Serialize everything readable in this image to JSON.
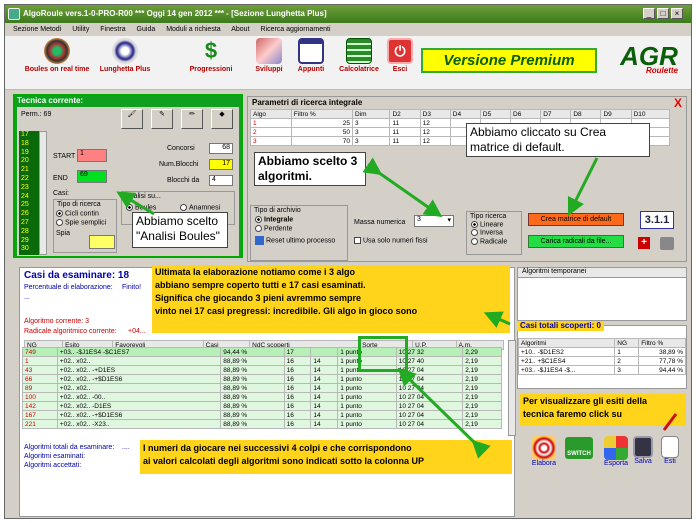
{
  "window": {
    "title": "AlgoRoule vers.1-0-PRO-R00  ***  Oggi 14 gen 2012  ***  - [Sezione Lunghetta Plus]"
  },
  "menu": [
    "Sezione Metodi",
    "Utility",
    "Finestra",
    "Guida",
    "Moduli a richiesta",
    "About",
    "Ricerca aggiornamenti"
  ],
  "toolbar": {
    "items": [
      "Boules on real time",
      "Lunghetta Plus",
      "Progressioni",
      "Sviluppi",
      "Appunti",
      "Calcolatrice",
      "Esci"
    ],
    "premium": "Versione Premium",
    "logo_main": "AGR",
    "logo_sub": "Roulette"
  },
  "left": {
    "title": "Tecnica corrente:",
    "perm": "Perm.: 69",
    "numbers": [
      "17",
      "18",
      "19",
      "20",
      "21",
      "22",
      "23",
      "24",
      "25",
      "26",
      "27",
      "28",
      "29",
      "30"
    ],
    "concorsi_label": "Concorsi",
    "concorsi_val": "68",
    "start_label": "START",
    "start_val": "1",
    "num_blocchi_label": "Num.Blocchi",
    "num_blocchi_val": "17",
    "end_label": "END",
    "end_val": "69",
    "blocchi_da_label": "Blocchi da",
    "blocchi_da_val": "4",
    "casi": "Casi:",
    "tipo_ricerca": "Tipo di ricerca",
    "cicli": "Cicli contin",
    "spie": "Spie semplici",
    "spia": "Spia",
    "analisi": "Analisi su...",
    "boules": "Boules",
    "anamnesi": "Anamnesi"
  },
  "params": {
    "title": "Parametri di ricerca integrale",
    "close": "X",
    "headers": [
      "Algo",
      "Filtro %",
      "Dim",
      "D2",
      "D3",
      "D4",
      "D5",
      "D6",
      "D7",
      "D8",
      "D9",
      "D10"
    ],
    "rows": [
      [
        "1",
        "25",
        "3",
        "11",
        "12"
      ],
      [
        "2",
        "50",
        "3",
        "11",
        "12"
      ],
      [
        "3",
        "70",
        "3",
        "11",
        "12"
      ]
    ],
    "archivio": "Tipo di archivio",
    "integrale": "Integrale",
    "perdente": "Perdente",
    "reset": "Reset ultimo processo",
    "massa": "Massa numerica",
    "massa_val": "3",
    "solo_fissi": "Usa solo numeri fissi",
    "tipo_ricerca": "Tipo ricerca",
    "lineare": "Lineare",
    "inversa": "Inversa",
    "radicale": "Radicale",
    "crea_btn": "Crea matrice di default",
    "carica_btn": "Carica radicali da file...",
    "version": "3.1.1"
  },
  "casi": {
    "title": "Casi da esaminare: 18",
    "perc": "Percentuale di elaborazione:",
    "finito": "Finito!",
    "dots": "...",
    "algo": "Algoritmo corrente: 3",
    "radice": "Radicale algoritmico corrente:",
    "radice_val": "+04...",
    "headers": [
      "NG",
      "Esito",
      "Favorevoli",
      "Casi",
      "NdC scoperti",
      "Sorte",
      "U.P.",
      "A.m."
    ],
    "rows": [
      [
        "749",
        "+03.. -$J1ES4 -$C1ES7",
        "94,44 %",
        "17",
        "",
        "1 punto",
        "10 27 32",
        "2,29"
      ],
      [
        "1",
        "+02.. x02..",
        "88,89 %",
        "16",
        "14",
        "1 punto",
        "10 27 40",
        "2,19"
      ],
      [
        "43",
        "+02.. x02.. -+D1ES",
        "88,89 %",
        "16",
        "14",
        "1 punto",
        "10 27 04",
        "2,19"
      ],
      [
        "66",
        "+02.. x02.. -+$D1ES6",
        "88,89 %",
        "16",
        "14",
        "1 punto",
        "10 27 04",
        "2,19"
      ],
      [
        "89",
        "+02.. x02..",
        "88,89 %",
        "16",
        "14",
        "1 punto",
        "10 27 04",
        "2,19"
      ],
      [
        "100",
        "+02.. x02.. -00..",
        "88,89 %",
        "16",
        "14",
        "1 punto",
        "10 27 04",
        "2,19"
      ],
      [
        "142",
        "+02.. x02.. -D1ES",
        "88,89 %",
        "16",
        "14",
        "1 punto",
        "10 27 04",
        "2,19"
      ],
      [
        "167",
        "+02.. x02.. -+$D1ES6",
        "88,89 %",
        "16",
        "14",
        "1 punto",
        "10 27 04",
        "2,19"
      ],
      [
        "221",
        "+02.. x02.. -X23..",
        "88,89 %",
        "16",
        "14",
        "1 punto",
        "10 27 04",
        "2,19"
      ]
    ],
    "tot1": "Algoritmi totali da esaminare:",
    "tot2": "Algoritmi esaminati:",
    "tot3": "Algoritmi accettati:",
    "tot_dots": "...."
  },
  "right": {
    "temp": "Algoritmi temporanei",
    "scoperti_label": "Casi totali scoperti:",
    "scoperti_val": "0",
    "headers": [
      "Algoritmi",
      "NG",
      "Filtro %"
    ],
    "rows": [
      [
        "+10.. -$D1ES2",
        "1",
        "38,89 %"
      ],
      [
        "+21.. +$C1ES4",
        "2",
        "77,78 %"
      ],
      [
        "+03.. -$J1ES4 -$...",
        "3",
        "94,44 %"
      ]
    ]
  },
  "bottom": [
    "Elabora",
    "Esporta",
    "Salva",
    "Esti"
  ],
  "switch": "SWITCH",
  "callouts": {
    "algo3": "Abbiamo scelto 3 algoritmi.",
    "crea": "Abbiamo cliccato su Crea matrice di default.",
    "boules": "Abbiamo scelto \"Analisi Boules\"",
    "main": [
      "Ultimata la elaborazione notiamo come i 3 algo",
      "abbiano sempre coperto tutti e 17 casi esaminati.",
      "Significa che giocando 3 pieni avremmo sempre",
      "vinto nei 17 casi pregressi: incredibile. Gli algo in gioco sono"
    ],
    "bottom": [
      "I numeri da giocare nei successivi 4 colpi e che corrispondono",
      "ai valori calcolati degli algoritmi  sono indicati sotto la colonna UP"
    ],
    "esiti": [
      "Per visualizzare gli esiti della",
      "tecnica faremo click su"
    ]
  }
}
